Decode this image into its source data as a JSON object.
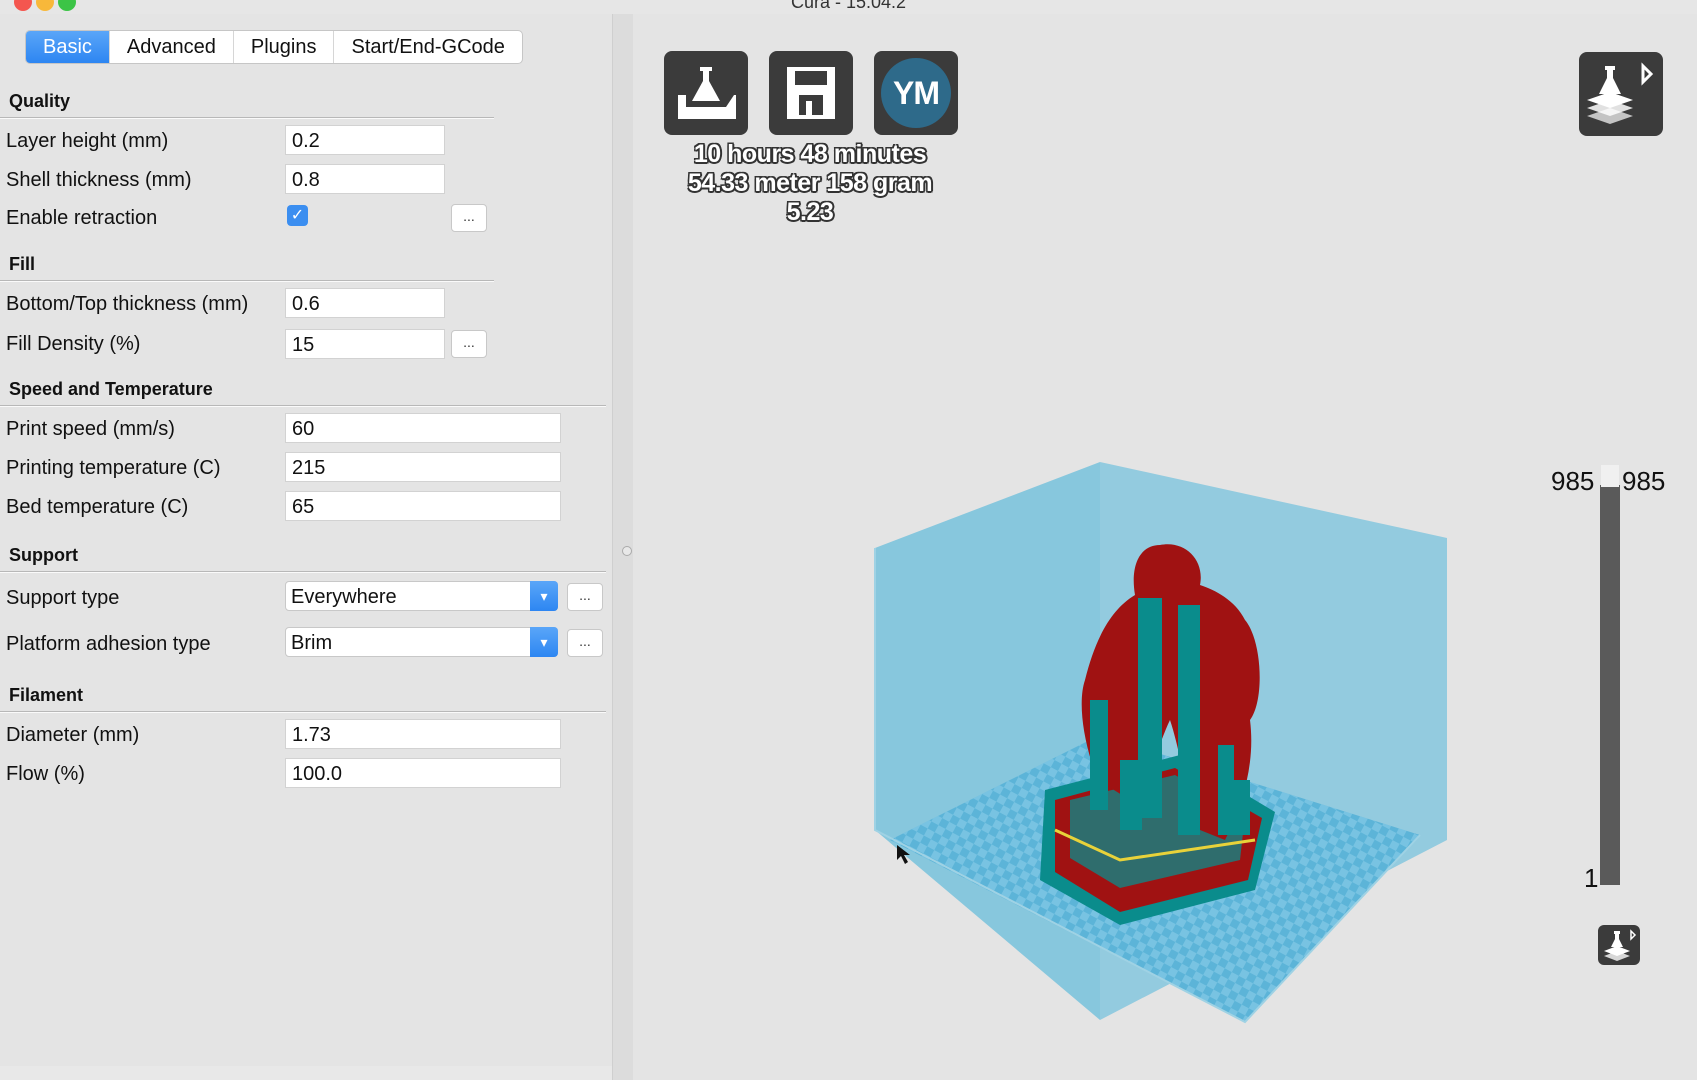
{
  "window": {
    "title": "Cura - 15.04.2"
  },
  "tabs": [
    {
      "label": "Basic",
      "active": true
    },
    {
      "label": "Advanced",
      "active": false
    },
    {
      "label": "Plugins",
      "active": false
    },
    {
      "label": "Start/End-GCode",
      "active": false
    }
  ],
  "quality": {
    "title": "Quality",
    "layer_height_label": "Layer height (mm)",
    "layer_height": "0.2",
    "shell_thickness_label": "Shell thickness (mm)",
    "shell_thickness": "0.8",
    "enable_retraction_label": "Enable retraction",
    "enable_retraction": true
  },
  "fill": {
    "title": "Fill",
    "bottom_top_label": "Bottom/Top thickness (mm)",
    "bottom_top": "0.6",
    "density_label": "Fill Density (%)",
    "density": "15"
  },
  "speed": {
    "title": "Speed and Temperature",
    "print_speed_label": "Print speed (mm/s)",
    "print_speed": "60",
    "print_temp_label": "Printing temperature (C)",
    "print_temp": "215",
    "bed_temp_label": "Bed temperature (C)",
    "bed_temp": "65"
  },
  "support": {
    "title": "Support",
    "type_label": "Support type",
    "type_value": "Everywhere",
    "adhesion_label": "Platform adhesion type",
    "adhesion_value": "Brim"
  },
  "filament": {
    "title": "Filament",
    "diameter_label": "Diameter (mm)",
    "diameter": "1.73",
    "flow_label": "Flow (%)",
    "flow": "100.0"
  },
  "more_button_label": "...",
  "viewer": {
    "toolbar": {
      "load_icon": "load-model-icon",
      "save_icon": "save-gcode-icon",
      "ym_label": "YM"
    },
    "stats": {
      "time": "10 hours 48 minutes",
      "material": "54.33 meter 158 gram",
      "cost": "5.23"
    },
    "layer_slider": {
      "top_left": "985",
      "top_right": "985",
      "bottom": "1",
      "level": 1.0
    },
    "colors": {
      "model": "#a01212",
      "support": "#0a8c8c",
      "volume": "#7cc3db",
      "bed": "#5cb4d8"
    }
  }
}
